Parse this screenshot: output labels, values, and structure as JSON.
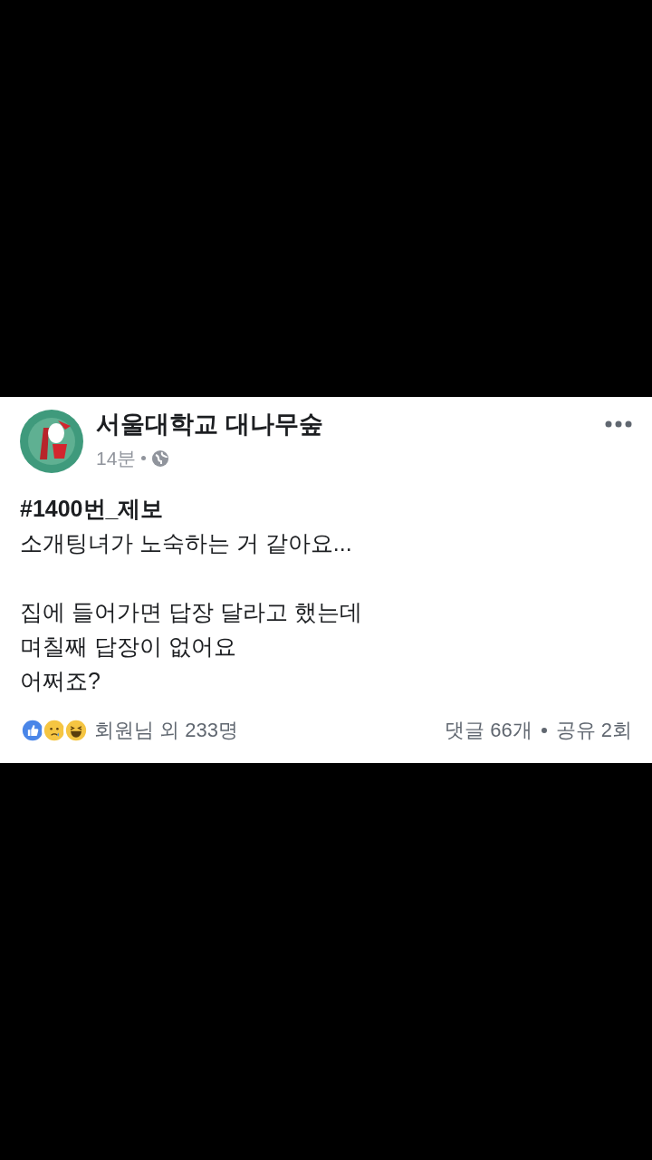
{
  "post": {
    "page_name": "서울대학교 대나무숲",
    "time": "14분",
    "public": true,
    "title": "#1400번_제보",
    "paragraphs": [
      [
        "소개팅녀가 노숙하는 거 같아요..."
      ],
      [
        "집에 들어가면 답장 달라고 했는데",
        "며칠째 답장이 없어요",
        "어쩌죠?"
      ]
    ],
    "reactions": [
      {
        "kind": "like"
      },
      {
        "kind": "sad"
      },
      {
        "kind": "haha"
      }
    ],
    "reaction_summary": "회원님 외 233명",
    "comments": "댓글 66개",
    "shares": "공유 2회"
  }
}
